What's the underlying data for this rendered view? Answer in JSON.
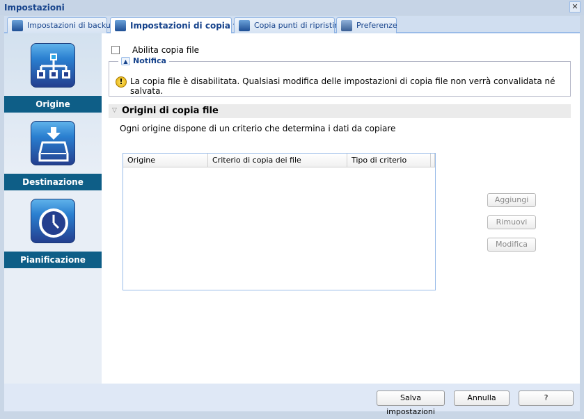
{
  "window": {
    "title": "Impostazioni",
    "close_icon": "close-icon"
  },
  "tabs": [
    {
      "label": "Impostazioni di backup",
      "icon": "backup-icon"
    },
    {
      "label": "Impostazioni di copia file",
      "icon": "file-copy-icon",
      "active": true
    },
    {
      "label": "Copia punti di ripristino",
      "icon": "recovery-point-icon"
    },
    {
      "label": "Preferenze",
      "icon": "gear-icon"
    }
  ],
  "sidebar": {
    "items": [
      {
        "label": "Origine",
        "icon": "hierarchy-icon",
        "active": true
      },
      {
        "label": "Destinazione",
        "icon": "drive-download-icon"
      },
      {
        "label": "Pianificazione",
        "icon": "clock-icon"
      }
    ]
  },
  "main": {
    "enable_label": "Abilita copia file",
    "enable_checked": false,
    "notice": {
      "title": "Notifica",
      "message": "La copia file è disabilitata. Qualsiasi modifica delle impostazioni di copia file non verrà convalidata né salvata."
    },
    "section": {
      "title": "Origini di copia file",
      "description": "Ogni origine dispone di un criterio che determina i dati da copiare"
    },
    "table": {
      "columns": [
        "Origine",
        "Criterio di copia dei file",
        "Tipo di criterio"
      ],
      "rows": []
    },
    "buttons": {
      "add": "Aggiungi",
      "remove": "Rimuovi",
      "edit": "Modifica"
    }
  },
  "footer": {
    "save": "Salva impostazioni",
    "cancel": "Annulla",
    "help": "?"
  }
}
